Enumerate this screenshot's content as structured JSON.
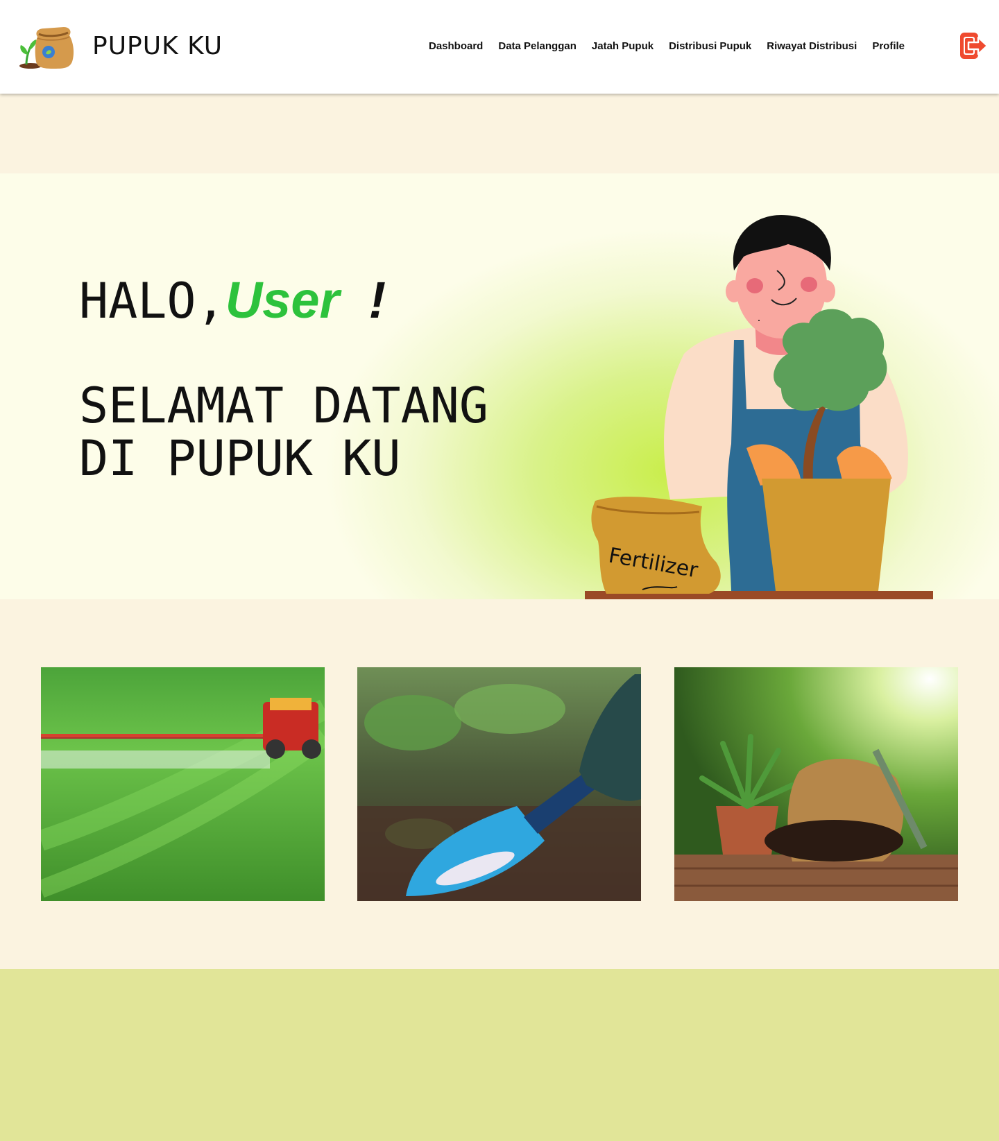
{
  "header": {
    "brand": "PUPUK KU",
    "logo_icon": "fertilizer-sack-logo",
    "logout_icon": "logout-icon",
    "nav": [
      {
        "label": "Dashboard"
      },
      {
        "label": "Data Pelanggan"
      },
      {
        "label": "Jatah Pupuk"
      },
      {
        "label": "Distribusi Pupuk"
      },
      {
        "label": "Riwayat Distribusi"
      },
      {
        "label": "Profile"
      }
    ]
  },
  "hero": {
    "greeting_prefix": "HALO,",
    "greeting_user": "User",
    "greeting_suffix": "!",
    "welcome_line1": "SELAMAT DATANG",
    "welcome_line2": "DI PUPUK KU",
    "illustration_label": "Fertilizer"
  },
  "photos": [
    {
      "icon": "tractor-spraying-field-photo"
    },
    {
      "icon": "shovel-fertilizer-photo"
    },
    {
      "icon": "potted-plant-soil-photo"
    }
  ],
  "colors": {
    "accent_green": "#2dc23c",
    "logout_red": "#ef4a2f",
    "page_bg": "#fbf3e0",
    "hero_bg": "#fdfde9",
    "footer_band": "#e1e598"
  }
}
